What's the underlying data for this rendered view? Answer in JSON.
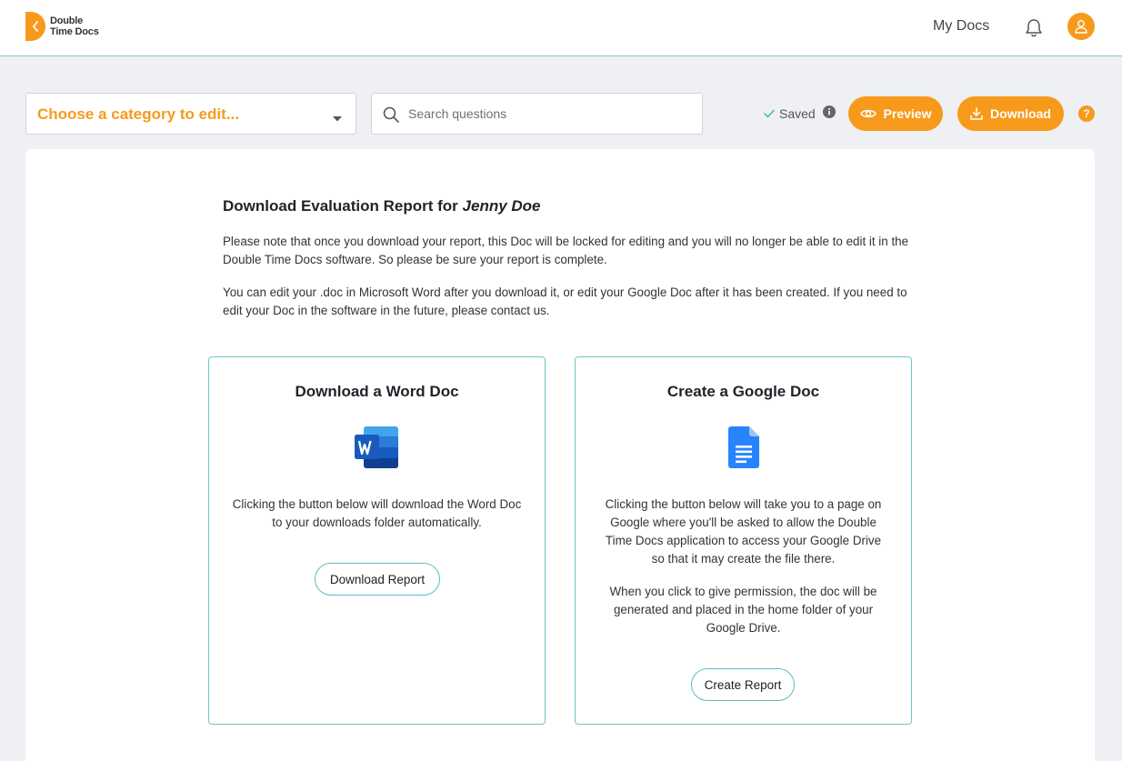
{
  "brand": {
    "name_line1": "Double",
    "name_line2": "Time Docs",
    "accent": "#f79a1c",
    "teal": "#6fc6c6"
  },
  "header": {
    "nav_my_docs": "My Docs",
    "icons": [
      "chevron-left-icon",
      "bell-icon",
      "user-icon"
    ]
  },
  "toolbar": {
    "category_placeholder": "Choose a category to edit...",
    "search_placeholder": "Search questions",
    "search_value": "",
    "saved_label": "Saved",
    "preview_label": "Preview",
    "download_label": "Download",
    "help_label": "?"
  },
  "main": {
    "title_prefix": "Download Evaluation Report for",
    "client_name": "Jenny Doe",
    "note1": "Please note that once you download your report, this Doc will be locked for editing and you will no longer be able to edit it in the Double Time Docs software. So please be sure your report is complete.",
    "note2": "You can edit your .doc in Microsoft Word after you download it, or edit your Google Doc after it has been created. If you need to edit your Doc in the software in the future, please contact us."
  },
  "word_card": {
    "heading": "Download a Word Doc",
    "description": "Clicking the button below will download the Word Doc to your downloads folder automatically.",
    "button_label": "Download Report",
    "icon": "word-doc-icon"
  },
  "google_card": {
    "heading": "Create a Google Doc",
    "description1": "Clicking the button below will take you to a page on Google where you'll be asked to allow the Double Time Docs application to access your Google Drive so that it may create the file there.",
    "description2": "When you click to give permission, the doc will be generated and placed in the home folder of your Google Drive.",
    "button_label": "Create Report",
    "icon": "google-doc-icon"
  }
}
